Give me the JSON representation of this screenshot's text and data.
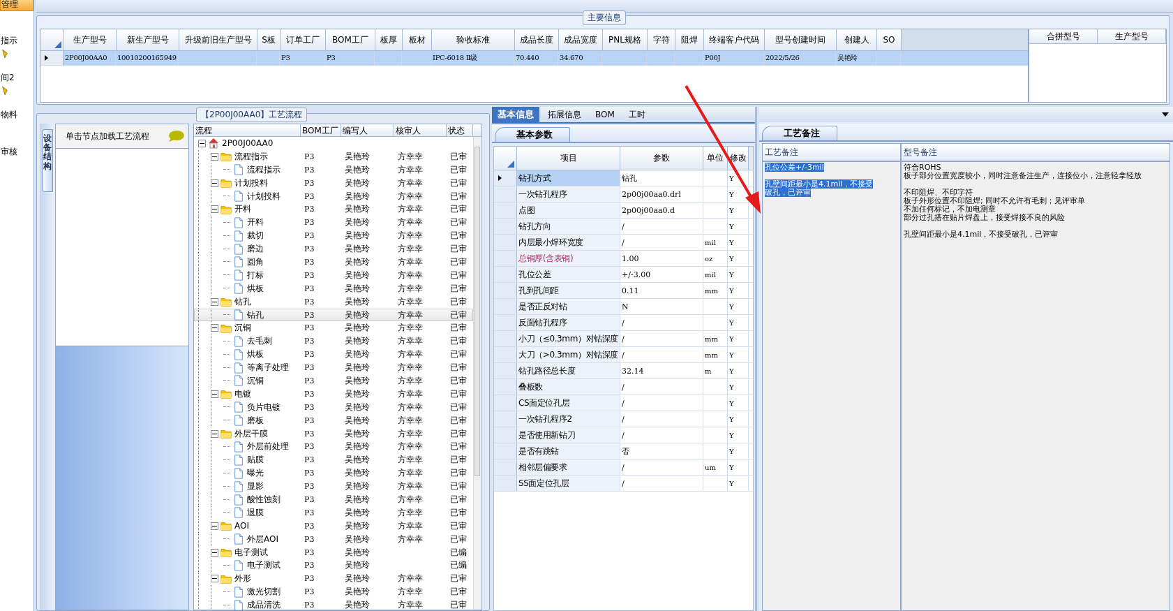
{
  "sidebar": {
    "items": [
      {
        "label": "管理",
        "selected": true,
        "icon": false
      },
      {
        "label": "指示",
        "selected": false,
        "icon": false
      },
      {
        "label": "间2",
        "selected": false,
        "icon": true
      },
      {
        "label": "物料",
        "selected": false,
        "icon": true
      },
      {
        "label": "审核",
        "selected": false,
        "icon": false
      }
    ]
  },
  "main_info": {
    "title": "主要信息",
    "columns": [
      "生产型号",
      "新生产型号",
      "升级前旧生产型号",
      "S板",
      "订单工厂",
      "BOM工厂",
      "板厚",
      "板材",
      "验收标准",
      "成品长度",
      "成品宽度",
      "PNL规格",
      "字符",
      "阻焊",
      "终端客户代码",
      "型号创建时间",
      "创建人",
      "SO"
    ],
    "rows": [
      {
        "selected": true,
        "cells": [
          "2P00J00AA0",
          "10010200165949",
          null,
          null,
          "P3",
          "P3",
          null,
          null,
          "IPC-6018 Ⅱ级",
          "70.440",
          "34.670",
          null,
          null,
          null,
          "P00J",
          "2022/5/26",
          "吴艳玲",
          null
        ]
      }
    ]
  },
  "merge_table": {
    "columns": [
      "合拼型号",
      "生产型号"
    ]
  },
  "process_flow": {
    "title": "【2P00J00AA0】工艺流程",
    "side_tab": "设备结构",
    "hint": "单击节点加载工艺流程",
    "columns": [
      "流程",
      "BOM工厂",
      "编写人",
      "核审人",
      "状态"
    ],
    "tree": [
      {
        "name": "2P00J00AA0",
        "kind": "root",
        "expanded": true,
        "selected": false,
        "children": [
          {
            "name": "流程指示",
            "kind": "folder",
            "expanded": true,
            "selected": false,
            "bom": "P3",
            "writer": "吴艳玲",
            "reviewer": "方幸幸",
            "status": "已审",
            "children": [
              {
                "name": "流程指示",
                "kind": "doc",
                "selected": false,
                "bom": "P3",
                "writer": "吴艳玲",
                "reviewer": "方幸幸",
                "status": "已审"
              }
            ]
          },
          {
            "name": "计划投料",
            "kind": "folder",
            "expanded": true,
            "selected": false,
            "bom": "P3",
            "writer": "吴艳玲",
            "reviewer": "方幸幸",
            "status": "已审",
            "children": [
              {
                "name": "计划投料",
                "kind": "doc",
                "selected": false,
                "bom": "P3",
                "writer": "吴艳玲",
                "reviewer": "方幸幸",
                "status": "已审"
              }
            ]
          },
          {
            "name": "开料",
            "kind": "folder",
            "expanded": true,
            "selected": false,
            "bom": "P3",
            "writer": "吴艳玲",
            "reviewer": "方幸幸",
            "status": "已审",
            "children": [
              {
                "name": "开料",
                "kind": "doc",
                "selected": false,
                "bom": "P3",
                "writer": "吴艳玲",
                "reviewer": "方幸幸",
                "status": "已审"
              },
              {
                "name": "裁切",
                "kind": "doc",
                "selected": false,
                "bom": "P3",
                "writer": "吴艳玲",
                "reviewer": "方幸幸",
                "status": "已审"
              },
              {
                "name": "磨边",
                "kind": "doc",
                "selected": false,
                "bom": "P3",
                "writer": "吴艳玲",
                "reviewer": "方幸幸",
                "status": "已审"
              },
              {
                "name": "圆角",
                "kind": "doc",
                "selected": false,
                "bom": "P3",
                "writer": "吴艳玲",
                "reviewer": "方幸幸",
                "status": "已审"
              },
              {
                "name": "打标",
                "kind": "doc",
                "selected": false,
                "bom": "P3",
                "writer": "吴艳玲",
                "reviewer": "方幸幸",
                "status": "已审"
              },
              {
                "name": "烘板",
                "kind": "doc",
                "selected": false,
                "bom": "P3",
                "writer": "吴艳玲",
                "reviewer": "方幸幸",
                "status": "已审"
              }
            ]
          },
          {
            "name": "钻孔",
            "kind": "folder",
            "expanded": true,
            "selected": false,
            "bom": "P3",
            "writer": "吴艳玲",
            "reviewer": "方幸幸",
            "status": "已审",
            "children": [
              {
                "name": "钻孔",
                "kind": "doc",
                "selected": true,
                "bom": "P3",
                "writer": "吴艳玲",
                "reviewer": "方幸幸",
                "status": "已审"
              }
            ]
          },
          {
            "name": "沉铜",
            "kind": "folder",
            "expanded": true,
            "selected": false,
            "bom": "P3",
            "writer": "吴艳玲",
            "reviewer": "方幸幸",
            "status": "已审",
            "children": [
              {
                "name": "去毛刺",
                "kind": "doc",
                "selected": false,
                "bom": "P3",
                "writer": "吴艳玲",
                "reviewer": "方幸幸",
                "status": "已审"
              },
              {
                "name": "烘板",
                "kind": "doc",
                "selected": false,
                "bom": "P3",
                "writer": "吴艳玲",
                "reviewer": "方幸幸",
                "status": "已审"
              },
              {
                "name": "等离子处理",
                "kind": "doc",
                "selected": false,
                "bom": "P3",
                "writer": "吴艳玲",
                "reviewer": "方幸幸",
                "status": "已审"
              },
              {
                "name": "沉铜",
                "kind": "doc",
                "selected": false,
                "bom": "P3",
                "writer": "吴艳玲",
                "reviewer": "方幸幸",
                "status": "已审"
              }
            ]
          },
          {
            "name": "电镀",
            "kind": "folder",
            "expanded": true,
            "selected": false,
            "bom": "P3",
            "writer": "吴艳玲",
            "reviewer": "方幸幸",
            "status": "已审",
            "children": [
              {
                "name": "负片电镀",
                "kind": "doc",
                "selected": false,
                "bom": "P3",
                "writer": "吴艳玲",
                "reviewer": "方幸幸",
                "status": "已审"
              },
              {
                "name": "磨板",
                "kind": "doc",
                "selected": false,
                "bom": "P3",
                "writer": "吴艳玲",
                "reviewer": "方幸幸",
                "status": "已审"
              }
            ]
          },
          {
            "name": "外层干膜",
            "kind": "folder",
            "expanded": true,
            "selected": false,
            "bom": "P3",
            "writer": "吴艳玲",
            "reviewer": "方幸幸",
            "status": "已审",
            "children": [
              {
                "name": "外层前处理",
                "kind": "doc",
                "selected": false,
                "bom": "P3",
                "writer": "吴艳玲",
                "reviewer": "方幸幸",
                "status": "已审"
              },
              {
                "name": "贴膜",
                "kind": "doc",
                "selected": false,
                "bom": "P3",
                "writer": "吴艳玲",
                "reviewer": "方幸幸",
                "status": "已审"
              },
              {
                "name": "曝光",
                "kind": "doc",
                "selected": false,
                "bom": "P3",
                "writer": "吴艳玲",
                "reviewer": "方幸幸",
                "status": "已审"
              },
              {
                "name": "显影",
                "kind": "doc",
                "selected": false,
                "bom": "P3",
                "writer": "吴艳玲",
                "reviewer": "方幸幸",
                "status": "已审"
              },
              {
                "name": "酸性蚀刻",
                "kind": "doc",
                "selected": false,
                "bom": "P3",
                "writer": "吴艳玲",
                "reviewer": "方幸幸",
                "status": "已审"
              },
              {
                "name": "退膜",
                "kind": "doc",
                "selected": false,
                "bom": "P3",
                "writer": "吴艳玲",
                "reviewer": "方幸幸",
                "status": "已审"
              }
            ]
          },
          {
            "name": "AOI",
            "kind": "folder",
            "expanded": true,
            "selected": false,
            "bom": "P3",
            "writer": "吴艳玲",
            "reviewer": "方幸幸",
            "status": "已审",
            "children": [
              {
                "name": "外层AOI",
                "kind": "doc",
                "selected": false,
                "bom": "P3",
                "writer": "吴艳玲",
                "reviewer": "方幸幸",
                "status": "已审"
              }
            ]
          },
          {
            "name": "电子测试",
            "kind": "folder",
            "expanded": true,
            "selected": false,
            "bom": "P3",
            "writer": "吴艳玲",
            "status": "已编",
            "children": [
              {
                "name": "电子测试",
                "kind": "doc",
                "selected": false,
                "bom": "P3",
                "writer": "吴艳玲",
                "status": "已编"
              }
            ]
          },
          {
            "name": "外形",
            "kind": "folder",
            "expanded": true,
            "selected": false,
            "bom": "P3",
            "writer": "吴艳玲",
            "reviewer": "方幸幸",
            "status": "已审",
            "children": [
              {
                "name": "激光切割",
                "kind": "doc",
                "selected": false,
                "bom": "P3",
                "writer": "吴艳玲",
                "reviewer": "方幸幸",
                "status": "已审"
              },
              {
                "name": "成品清洗",
                "kind": "doc",
                "selected": false,
                "bom": "P3",
                "writer": "吴艳玲",
                "reviewer": "方幸幸",
                "status": "已审"
              }
            ]
          }
        ]
      }
    ]
  },
  "params": {
    "tabs": [
      {
        "label": "基本信息",
        "selected": true
      },
      {
        "label": "拓展信息",
        "selected": false
      },
      {
        "label": "BOM",
        "selected": false
      },
      {
        "label": "工时",
        "selected": false
      }
    ],
    "subtab": "基本参数",
    "columns": [
      "项目",
      "参数",
      "单位",
      "修改"
    ],
    "rows": [
      {
        "item": "钻孔方式",
        "value": "钻孔",
        "modify": "Y",
        "selected": true,
        "highlighted": false
      },
      {
        "item": "一次钻孔程序",
        "value": "2p00j00aa0.drl",
        "modify": "Y",
        "selected": false,
        "highlighted": false
      },
      {
        "item": "点图",
        "value": "2p00j00aa0.d",
        "modify": "Y",
        "selected": false,
        "highlighted": false
      },
      {
        "item": "钻孔方向",
        "value": "/",
        "modify": "Y",
        "selected": false,
        "highlighted": false
      },
      {
        "item": "内层最小焊环宽度",
        "value": "/",
        "unit": "mil",
        "modify": "Y",
        "selected": false,
        "highlighted": false
      },
      {
        "item": "总铜厚(含表铜)",
        "value": "1.00",
        "unit": "oz",
        "modify": "Y",
        "selected": false,
        "highlighted": true
      },
      {
        "item": "孔位公差",
        "value": "+/-3.00",
        "unit": "mil",
        "modify": "Y",
        "selected": false,
        "highlighted": false
      },
      {
        "item": "孔到孔间距",
        "value": "0.11",
        "unit": "mm",
        "modify": "Y",
        "selected": false,
        "highlighted": false
      },
      {
        "item": "是否正反对钻",
        "value": "N",
        "modify": "Y",
        "selected": false,
        "highlighted": false
      },
      {
        "item": "反面钻孔程序",
        "value": "/",
        "modify": "Y",
        "selected": false,
        "highlighted": false
      },
      {
        "item": "小刀（≤0.3mm）对钻深度",
        "value": "/",
        "unit": "mm",
        "modify": "Y",
        "selected": false,
        "highlighted": false
      },
      {
        "item": "大刀（>0.3mm）对钻深度",
        "value": "/",
        "unit": "mm",
        "modify": "Y",
        "selected": false,
        "highlighted": false
      },
      {
        "item": "钻孔路径总长度",
        "value": "32.14",
        "unit": "m",
        "modify": "Y",
        "selected": false,
        "highlighted": false
      },
      {
        "item": "叠板数",
        "value": "/",
        "modify": "Y",
        "selected": false,
        "highlighted": false
      },
      {
        "item": "CS面定位孔层",
        "value": "/",
        "modify": "Y",
        "selected": false,
        "highlighted": false
      },
      {
        "item": "一次钻孔程序2",
        "value": "/",
        "modify": "Y",
        "selected": false,
        "highlighted": false
      },
      {
        "item": "是否使用新钻刀",
        "value": "/",
        "modify": "Y",
        "selected": false,
        "highlighted": false
      },
      {
        "item": "是否有跳钻",
        "value": "否",
        "modify": "Y",
        "selected": false,
        "highlighted": false
      },
      {
        "item": "相邻层偏要求",
        "value": "/",
        "unit": "um",
        "modify": "Y",
        "selected": false,
        "highlighted": false
      },
      {
        "item": "SS面定位孔层",
        "value": "/",
        "modify": "Y",
        "selected": false,
        "highlighted": false
      }
    ]
  },
  "notes": {
    "subtab": "工艺备注",
    "columns": [
      "工艺备注",
      "型号备注"
    ],
    "process_note": {
      "selected": true,
      "paragraphs": [
        [
          "孔位公差+/-3mil"
        ],
        [
          "孔壁间距最小是4.1mil，不接受破孔，已评审"
        ]
      ]
    },
    "model_note": {
      "selected": false,
      "paragraphs": [
        [
          "符合ROHS",
          "板子部分位置宽度较小，同时注意备注生产，连接位小，注意轻拿轻放"
        ],
        [
          "不印阻焊、不印字符",
          "板子外形位置不印阻焊; 同时不允许有毛刺；见评审单",
          "不加任何标记，不加电测章",
          "部分过孔搭在贴片焊盘上，接受焊接不良的风险"
        ],
        [
          "孔壁间距最小是4.1mil，不接受破孔，已评审"
        ]
      ]
    }
  }
}
